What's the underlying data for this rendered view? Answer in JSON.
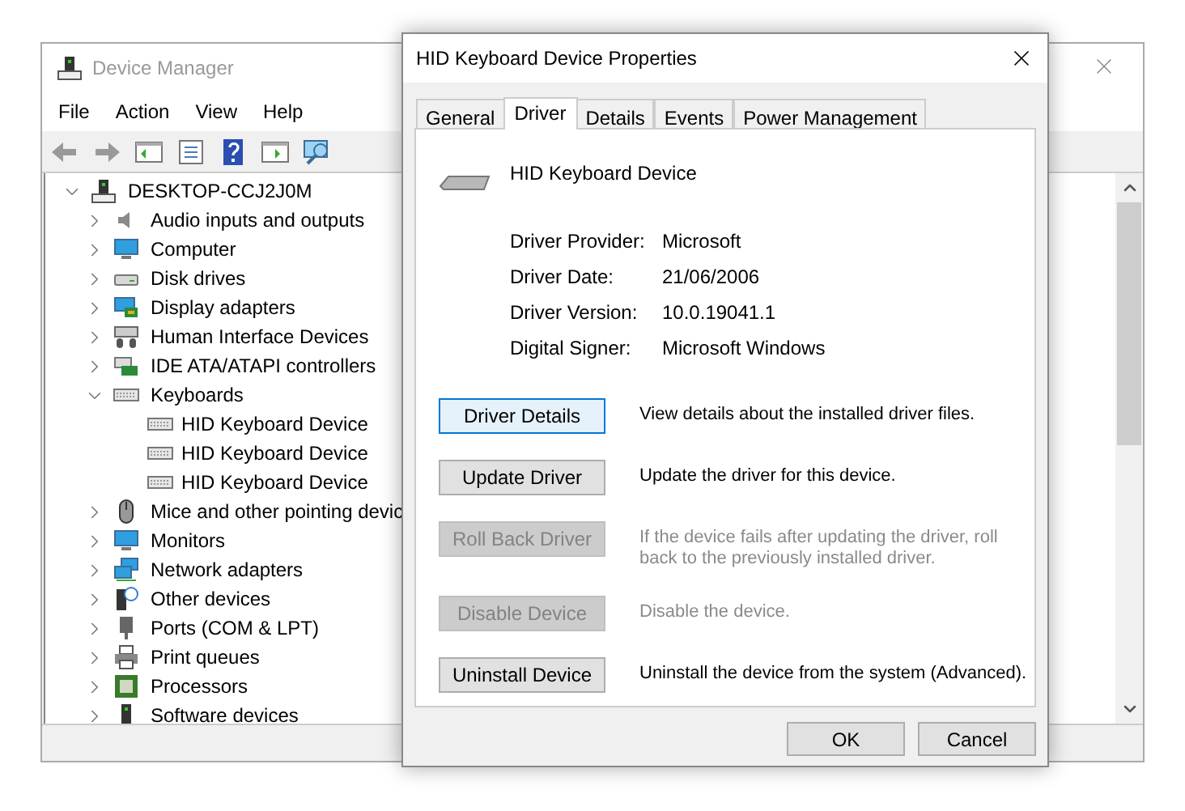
{
  "device_manager": {
    "title": "Device Manager",
    "menu": [
      "File",
      "Action",
      "View",
      "Help"
    ],
    "tree": [
      {
        "label": "DESKTOP-CCJ2J0M",
        "expanded": true,
        "children": [
          {
            "label": "Audio inputs and outputs",
            "expanded": false
          },
          {
            "label": "Computer",
            "expanded": false
          },
          {
            "label": "Disk drives",
            "expanded": false
          },
          {
            "label": "Display adapters",
            "expanded": false
          },
          {
            "label": "Human Interface Devices",
            "expanded": false
          },
          {
            "label": "IDE ATA/ATAPI controllers",
            "expanded": false
          },
          {
            "label": "Keyboards",
            "expanded": true,
            "children": [
              {
                "label": "HID Keyboard Device"
              },
              {
                "label": "HID Keyboard Device"
              },
              {
                "label": "HID Keyboard Device"
              }
            ]
          },
          {
            "label": "Mice and other pointing devic",
            "expanded": false
          },
          {
            "label": "Monitors",
            "expanded": false
          },
          {
            "label": "Network adapters",
            "expanded": false
          },
          {
            "label": "Other devices",
            "expanded": false
          },
          {
            "label": "Ports (COM & LPT)",
            "expanded": false
          },
          {
            "label": "Print queues",
            "expanded": false
          },
          {
            "label": "Processors",
            "expanded": false
          },
          {
            "label": "Software devices",
            "expanded": false
          }
        ]
      }
    ]
  },
  "dialog": {
    "title": "HID Keyboard Device Properties",
    "tabs": [
      {
        "label": "General",
        "selected": false
      },
      {
        "label": "Driver",
        "selected": true
      },
      {
        "label": "Details",
        "selected": false
      },
      {
        "label": "Events",
        "selected": false
      },
      {
        "label": "Power Management",
        "selected": false
      }
    ],
    "device_name": "HID Keyboard Device",
    "properties": [
      {
        "label": "Driver Provider:",
        "value": "Microsoft"
      },
      {
        "label": "Driver Date:",
        "value": "21/06/2006"
      },
      {
        "label": "Driver Version:",
        "value": "10.0.19041.1"
      },
      {
        "label": "Digital Signer:",
        "value": "Microsoft Windows"
      }
    ],
    "actions": [
      {
        "button": "Driver Details",
        "description": "View details about the installed driver files.",
        "disabled": false,
        "focused": true
      },
      {
        "button": "Update Driver",
        "description": "Update the driver for this device.",
        "disabled": false,
        "focused": false
      },
      {
        "button": "Roll Back Driver",
        "description": "If the device fails after updating the driver, roll back to the previously installed driver.",
        "disabled": true,
        "focused": false
      },
      {
        "button": "Disable Device",
        "description": "Disable the device.",
        "disabled": true,
        "focused": false
      },
      {
        "button": "Uninstall Device",
        "description": "Uninstall the device from the system (Advanced).",
        "disabled": false,
        "focused": false
      }
    ],
    "footer_buttons": [
      "OK",
      "Cancel"
    ]
  }
}
